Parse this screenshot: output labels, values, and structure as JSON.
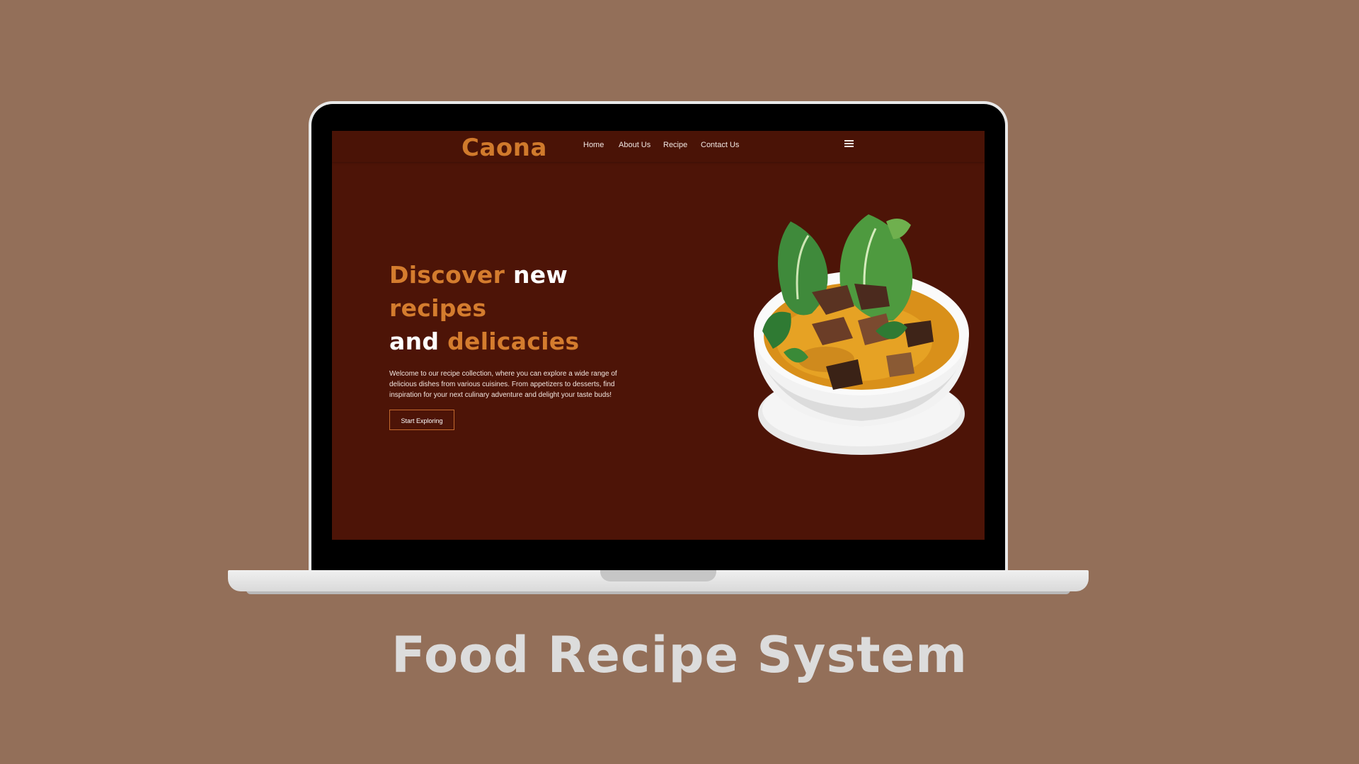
{
  "site": {
    "brand": "Caona",
    "nav": {
      "home": "Home",
      "about": "About Us",
      "recipe": "Recipe",
      "contact": "Contact Us"
    },
    "menu_icon": "hamburger-menu-icon"
  },
  "hero": {
    "title_discover": "Discover",
    "title_new": "new",
    "title_recipes": "recipes",
    "title_and": "and",
    "title_delicacies": "delicacies",
    "description": "Welcome to our recipe collection, where you can explore a wide range of delicious dishes from various cuisines. From appetizers to desserts, find inspiration for your next culinary adventure and delight your taste buds!",
    "cta_label": "Start Exploring",
    "image": "soup-bowl-with-bok-choy-image"
  },
  "caption": "Food Recipe System",
  "colors": {
    "background": "#936f59",
    "screen": "#4d1407",
    "accent": "#d47c2e",
    "caption": "#dcdcdc"
  }
}
